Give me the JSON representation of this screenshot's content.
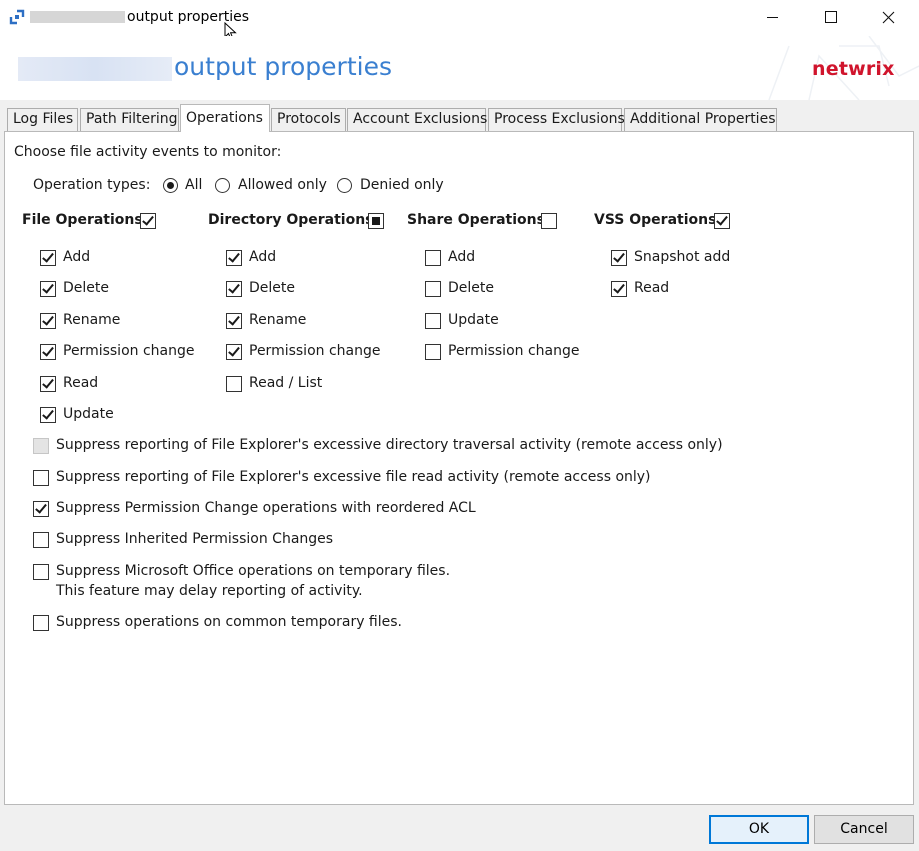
{
  "window": {
    "title": "output properties",
    "header_title": "output properties",
    "brand": "netwrix"
  },
  "colors": {
    "accent": "#3a7fd0",
    "brand": "#d0142c"
  },
  "tabs": [
    {
      "label": "Log Files",
      "active": false
    },
    {
      "label": "Path Filtering",
      "active": false
    },
    {
      "label": "Operations",
      "active": true
    },
    {
      "label": "Protocols",
      "active": false
    },
    {
      "label": "Account Exclusions",
      "active": false
    },
    {
      "label": "Process Exclusions",
      "active": false
    },
    {
      "label": "Additional Properties",
      "active": false
    }
  ],
  "operations": {
    "intro": "Choose file activity events to monitor:",
    "types_label": "Operation types:",
    "types": [
      {
        "label": "All",
        "selected": true
      },
      {
        "label": "Allowed only",
        "selected": false
      },
      {
        "label": "Denied only",
        "selected": false
      }
    ],
    "groups": {
      "file": {
        "label": "File Operations:",
        "state": "checked",
        "items": [
          {
            "label": "Add",
            "checked": true
          },
          {
            "label": "Delete",
            "checked": true
          },
          {
            "label": "Rename",
            "checked": true
          },
          {
            "label": "Permission change",
            "checked": true
          },
          {
            "label": "Read",
            "checked": true
          },
          {
            "label": "Update",
            "checked": true
          }
        ]
      },
      "directory": {
        "label": "Directory Operations:",
        "state": "indeterminate",
        "items": [
          {
            "label": "Add",
            "checked": true
          },
          {
            "label": "Delete",
            "checked": true
          },
          {
            "label": "Rename",
            "checked": true
          },
          {
            "label": "Permission change",
            "checked": true
          },
          {
            "label": "Read / List",
            "checked": false
          }
        ]
      },
      "share": {
        "label": "Share Operations:",
        "state": "unchecked",
        "items": [
          {
            "label": "Add",
            "checked": false
          },
          {
            "label": "Delete",
            "checked": false
          },
          {
            "label": "Update",
            "checked": false
          },
          {
            "label": "Permission change",
            "checked": false
          }
        ]
      },
      "vss": {
        "label": "VSS Operations:",
        "state": "checked",
        "items": [
          {
            "label": "Snapshot add",
            "checked": true
          },
          {
            "label": "Read",
            "checked": true
          }
        ]
      }
    },
    "options": [
      {
        "label": "Suppress reporting of File Explorer's excessive directory traversal activity (remote access only)",
        "checked": false,
        "disabled": true
      },
      {
        "label": "Suppress reporting of File Explorer's excessive file read activity (remote access only)",
        "checked": false,
        "disabled": false
      },
      {
        "label": "Suppress Permission Change operations with reordered ACL",
        "checked": true,
        "disabled": false
      },
      {
        "label": "Suppress Inherited Permission Changes",
        "checked": false,
        "disabled": false
      },
      {
        "label": "Suppress Microsoft Office operations on temporary files.",
        "sublabel": "This feature may delay reporting of activity.",
        "checked": false,
        "disabled": false
      },
      {
        "label": "Suppress operations on common temporary files.",
        "checked": false,
        "disabled": false
      }
    ]
  },
  "footer": {
    "ok": "OK",
    "cancel": "Cancel"
  }
}
